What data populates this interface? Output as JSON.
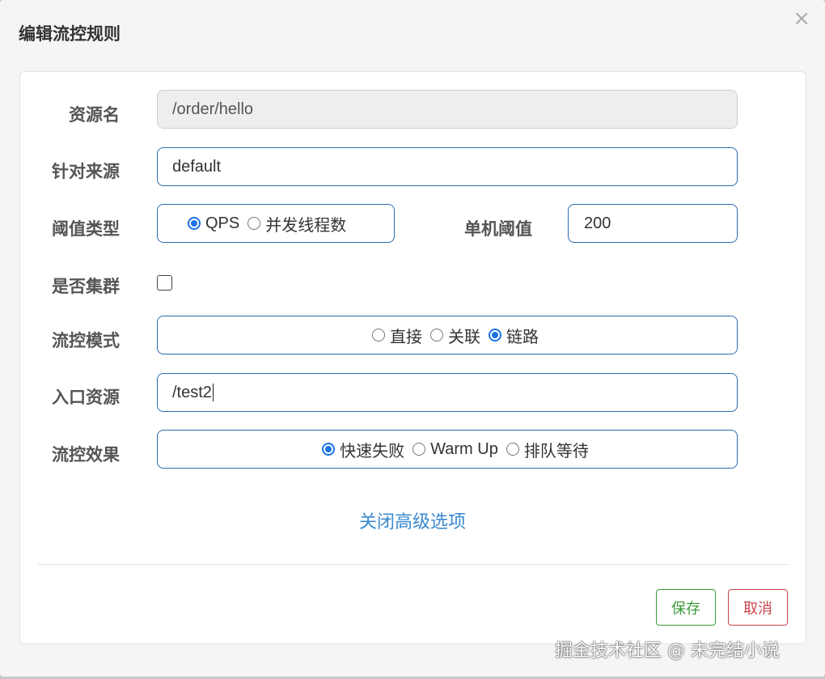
{
  "dialog": {
    "title": "编辑流控规则",
    "close_glyph": "×"
  },
  "form": {
    "resource_name": {
      "label": "资源名",
      "value": "/order/hello"
    },
    "limit_app": {
      "label": "针对来源",
      "value": "default"
    },
    "grade": {
      "label": "阈值类型",
      "options": [
        {
          "label": "QPS",
          "selected": true
        },
        {
          "label": "并发线程数",
          "selected": false
        }
      ]
    },
    "threshold": {
      "label": "单机阈值",
      "value": "200"
    },
    "cluster": {
      "label": "是否集群",
      "checked": false
    },
    "strategy": {
      "label": "流控模式",
      "options": [
        {
          "label": "直接",
          "selected": false
        },
        {
          "label": "关联",
          "selected": false
        },
        {
          "label": "链路",
          "selected": true
        }
      ]
    },
    "ref_resource": {
      "label": "入口资源",
      "value": "/test2"
    },
    "control_behavior": {
      "label": "流控效果",
      "options": [
        {
          "label": "快速失败",
          "selected": true
        },
        {
          "label": "Warm Up",
          "selected": false
        },
        {
          "label": "排队等待",
          "selected": false
        }
      ]
    },
    "advanced_toggle": "关闭高级选项"
  },
  "footer": {
    "save_label": "保存",
    "cancel_label": "取消"
  },
  "watermark": "掘金技术社区 @ 未完结小说",
  "colors": {
    "accent": "#1a73e8",
    "border": "#2d6ab2",
    "link": "#3a8ad0",
    "save": "#3a9a3a",
    "cancel": "#c9444a"
  }
}
